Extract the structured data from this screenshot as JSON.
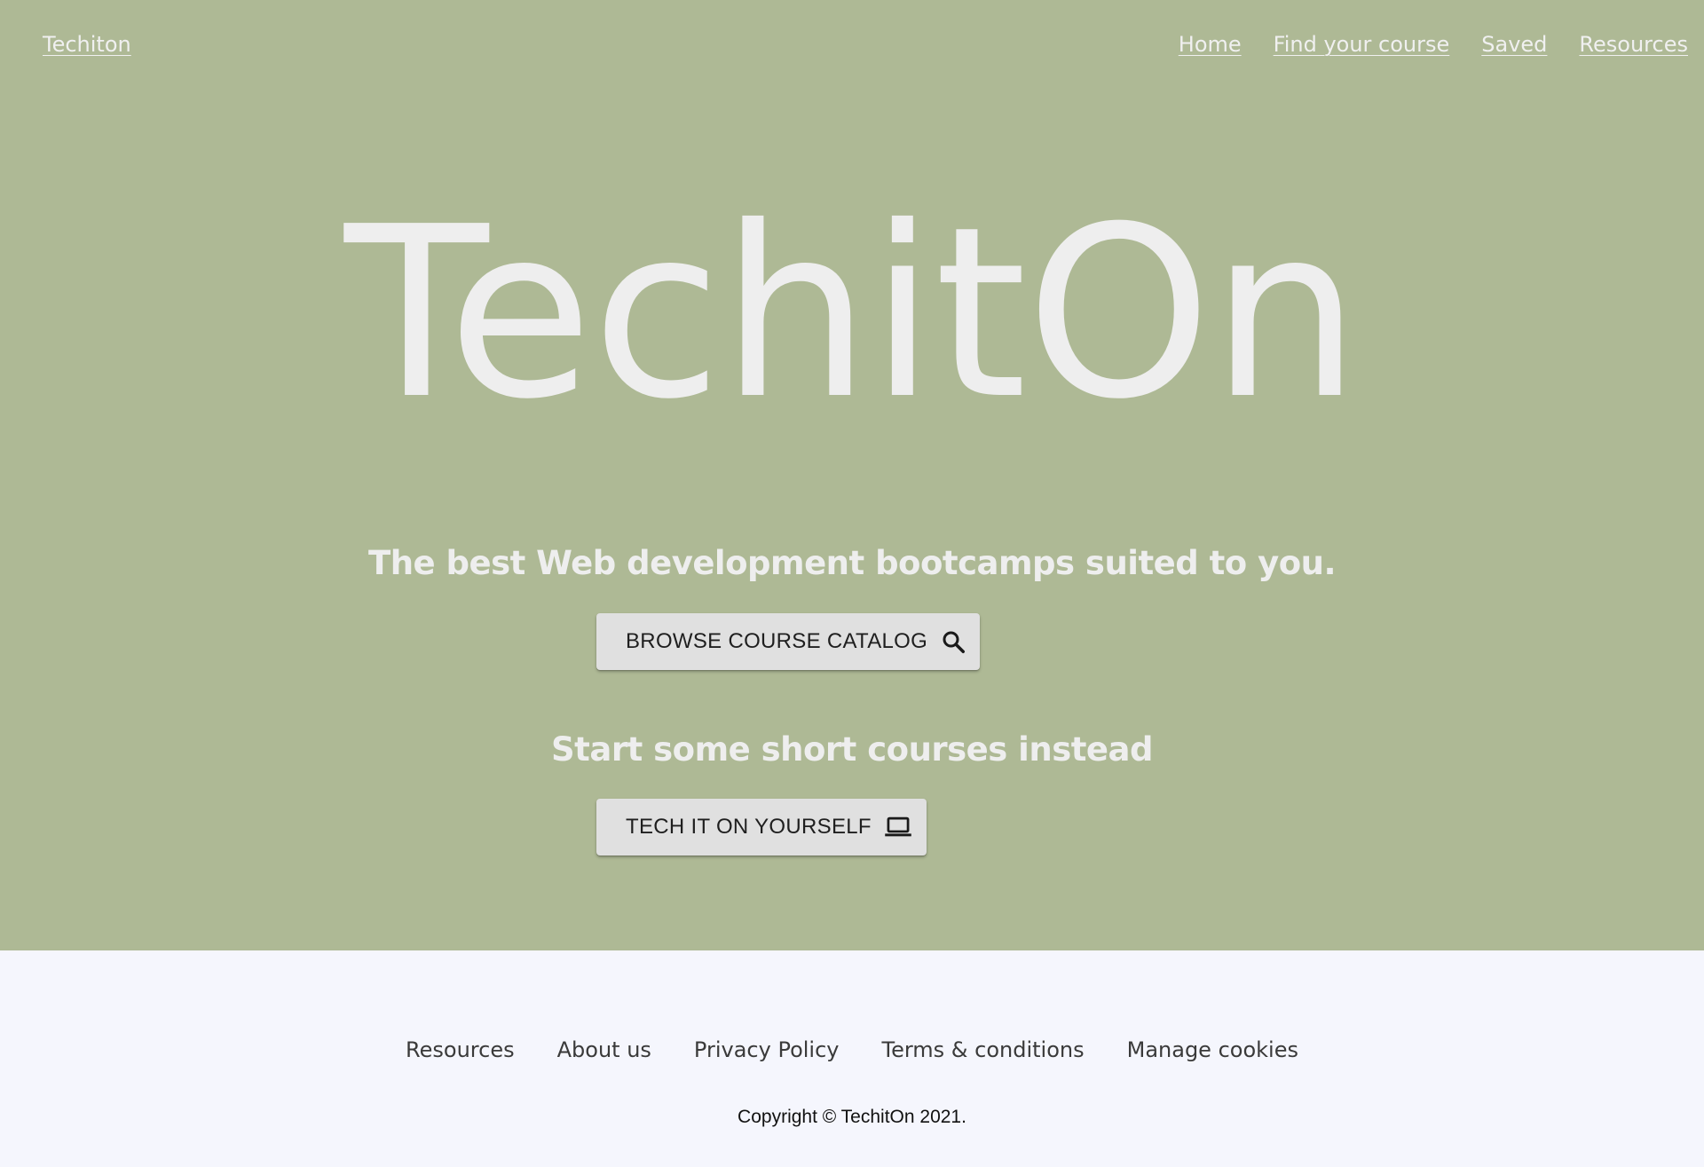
{
  "navbar": {
    "brand": "Techiton",
    "links": [
      "Home",
      "Find your course",
      "Saved",
      "Resources"
    ]
  },
  "hero": {
    "title": "TechitOn",
    "tagline": "The best Web development bootcamps suited to you.",
    "browse_button": {
      "label": "BROWSE COURSE CATALOG",
      "icon": "search-icon"
    },
    "subline": "Start some short courses instead",
    "tech_button": {
      "label": "TECH IT ON YOURSELF",
      "icon": "laptop-icon"
    }
  },
  "footer": {
    "links": [
      "Resources",
      "About us",
      "Privacy Policy",
      "Terms & conditions",
      "Manage cookies"
    ],
    "copyright": "Copyright © TechitOn 2021."
  },
  "colors": {
    "hero_background": "#aeb995",
    "footer_background": "#f5f6fd",
    "hero_text": "#eeeeee",
    "button_background": "#e0e0e0"
  }
}
